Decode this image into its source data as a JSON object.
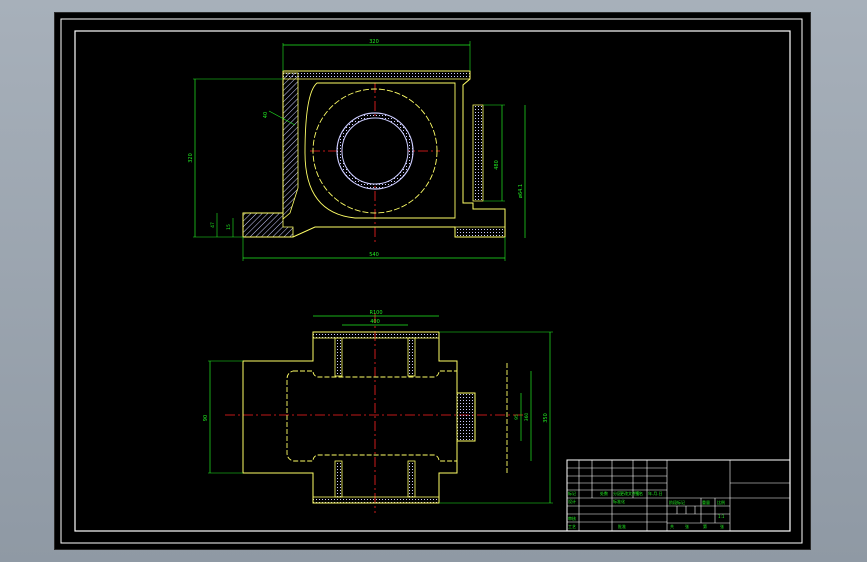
{
  "app": {
    "view_background": "#000000",
    "app_background": "#a3acb6",
    "colors": {
      "frame": "#ffffff",
      "outline": "#ffff66",
      "dimension": "#22ee22",
      "centerline": "#ff2222",
      "hatch": "#ccccff",
      "table": "#ffffff",
      "table_text": "#22ee22"
    }
  },
  "drawing": {
    "front_view": {
      "dims": {
        "top_width": "320",
        "total_height": "320",
        "wall": "40",
        "base_width": "540",
        "foot_h": "47",
        "foot_h2": "15",
        "bore": "480",
        "bore_tol": "ø64.1"
      }
    },
    "top_view": {
      "dims": {
        "top_a": "R100",
        "top_b": "400",
        "left_h": "90",
        "right_a": "95",
        "right_b": "360",
        "right_c": "350"
      }
    },
    "title_block": {
      "labels": [
        "标记",
        "处数",
        "分区",
        "更改文件号",
        "签名",
        "年.月.日",
        "设计",
        "标准化",
        "审核",
        "工艺",
        "批准",
        "阶段标记",
        "重量",
        "比例",
        "共",
        "张",
        "第",
        "张",
        "1:1"
      ]
    }
  }
}
